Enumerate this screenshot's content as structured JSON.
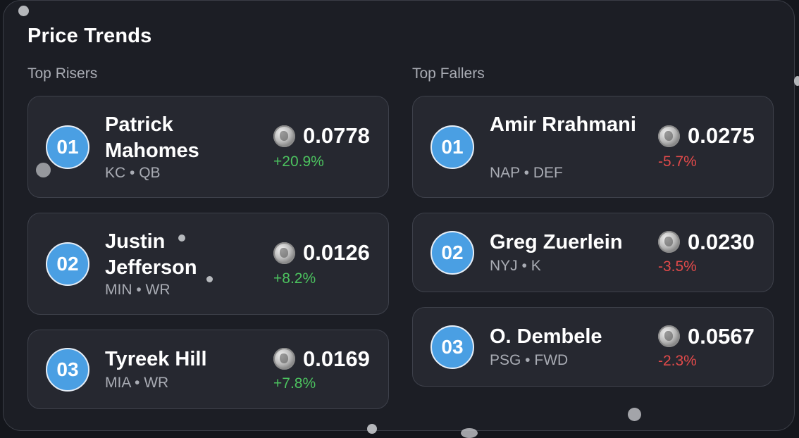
{
  "title": "Price Trends",
  "colors": {
    "rise": "#4cc35f",
    "fall": "#e24a4a",
    "rank_badge": "#4a9fe3"
  },
  "coin_icon": "silver-coin-icon",
  "risers": {
    "label": "Top Risers",
    "items": [
      {
        "rank": "01",
        "name": "Patrick Mahomes",
        "meta": "KC • QB",
        "price": "0.0778",
        "change": "+20.9%"
      },
      {
        "rank": "02",
        "name": "Justin Jefferson",
        "meta": "MIN • WR",
        "price": "0.0126",
        "change": "+8.2%"
      },
      {
        "rank": "03",
        "name": "Tyreek Hill",
        "meta": "MIA • WR",
        "price": "0.0169",
        "change": "+7.8%"
      }
    ]
  },
  "fallers": {
    "label": "Top Fallers",
    "items": [
      {
        "rank": "01",
        "name": "Amir Rrahmani",
        "meta": "NAP • DEF",
        "price": "0.0275",
        "change": "-5.7%"
      },
      {
        "rank": "02",
        "name": "Greg Zuerlein",
        "meta": "NYJ • K",
        "price": "0.0230",
        "change": "-3.5%"
      },
      {
        "rank": "03",
        "name": "O. Dembele",
        "meta": "PSG • FWD",
        "price": "0.0567",
        "change": "-2.3%"
      }
    ]
  }
}
